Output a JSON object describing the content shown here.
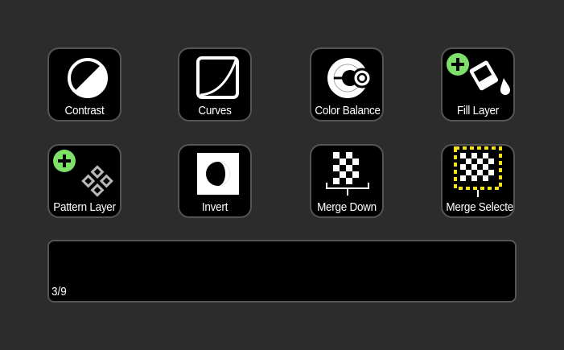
{
  "keys": [
    {
      "label": "Contrast",
      "icon": "contrast-icon"
    },
    {
      "label": "Curves",
      "icon": "curves-icon"
    },
    {
      "label": "Color Balance",
      "icon": "color-balance-icon"
    },
    {
      "label": "Fill Layer",
      "icon": "fill-layer-icon"
    },
    {
      "label": "Pattern Layer",
      "icon": "pattern-layer-icon"
    },
    {
      "label": "Invert",
      "icon": "invert-icon"
    },
    {
      "label": "Merge Down",
      "icon": "merge-down-icon"
    },
    {
      "label": "Merge Selected",
      "icon": "merge-selected-icon"
    }
  ],
  "display": {
    "page_indicator": "3/9"
  },
  "colors": {
    "background": "#2c2c2c",
    "key_face": "#000000",
    "key_border": "#555555",
    "add_badge": "#7ee06b",
    "selection_marquee": "#f5e21a"
  }
}
